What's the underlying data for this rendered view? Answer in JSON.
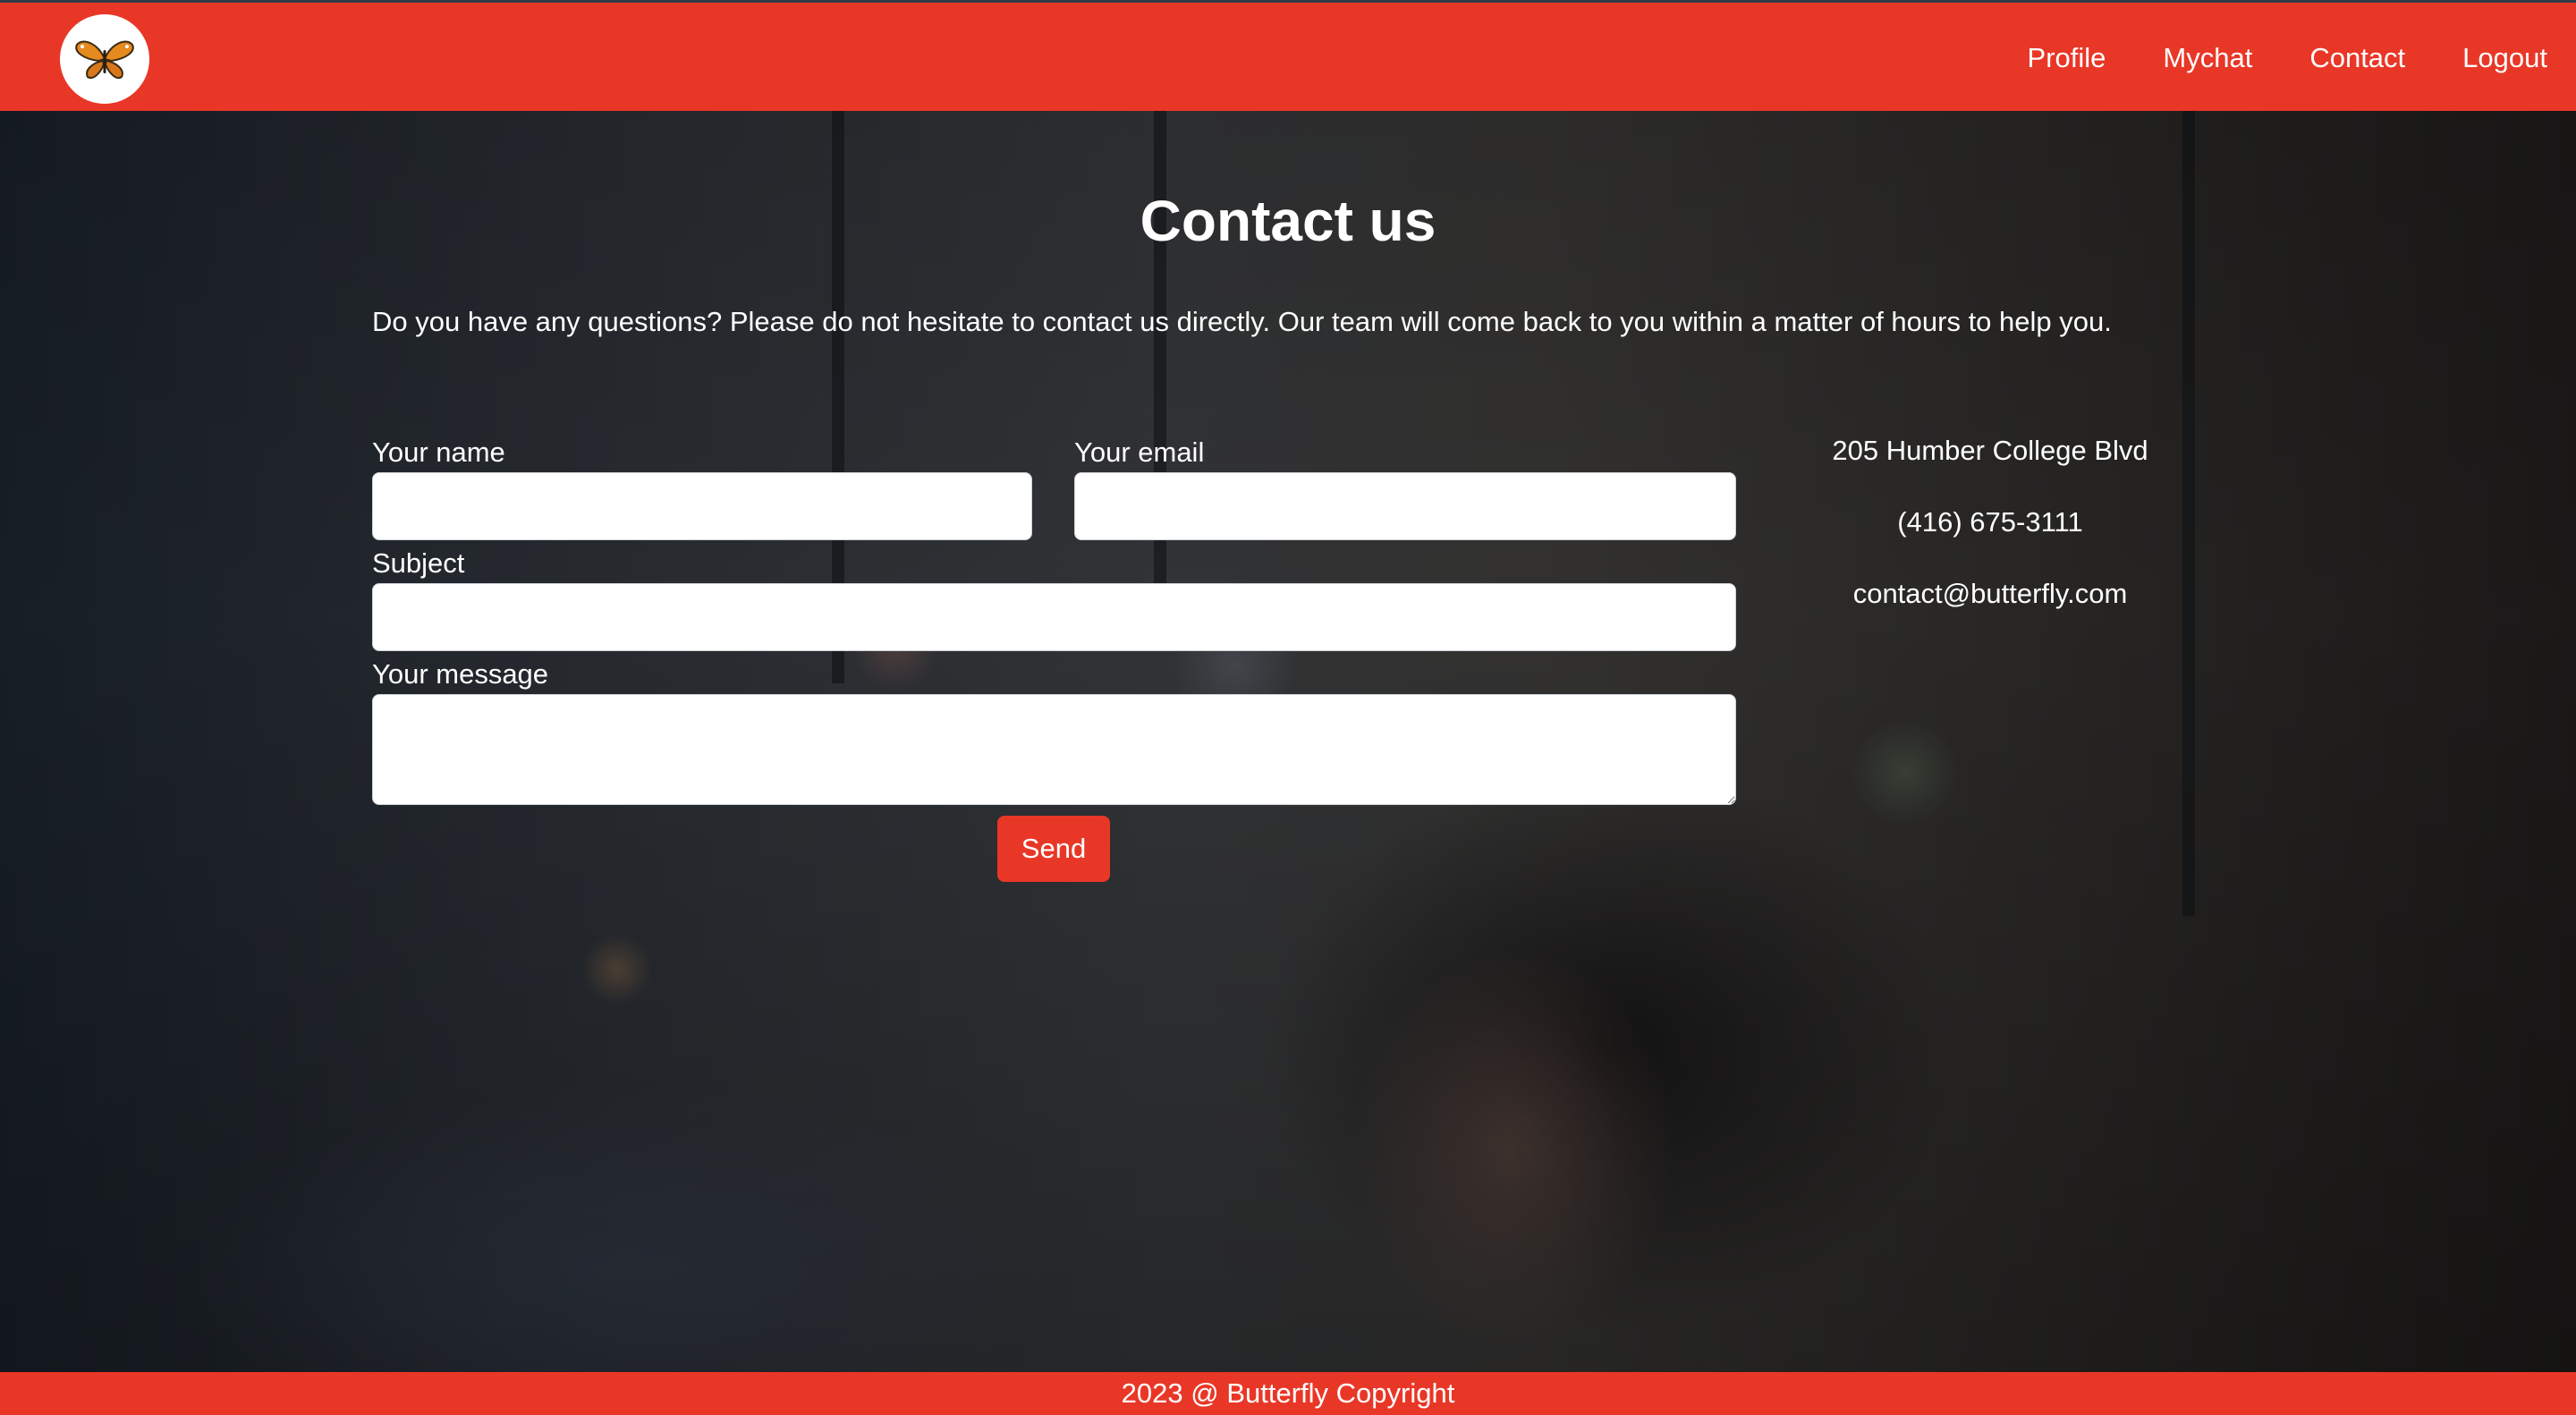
{
  "header": {
    "nav": [
      "Profile",
      "Mychat",
      "Contact",
      "Logout"
    ]
  },
  "main": {
    "title": "Contact us",
    "intro": "Do you have any questions? Please do not hesitate to contact us directly. Our team will come back to you within a matter of hours to help you.",
    "form": {
      "name_label": "Your name",
      "name_value": "",
      "email_label": "Your email",
      "email_value": "",
      "subject_label": "Subject",
      "subject_value": "",
      "message_label": "Your message",
      "message_value": "",
      "send_label": "Send"
    },
    "contact": {
      "address": "205 Humber College Blvd",
      "phone": "(416) 675-3111",
      "email": "contact@butterfly.com"
    }
  },
  "footer": {
    "text": "2023 @ Butterfly Copyright"
  },
  "colors": {
    "brand_red": "#e93727",
    "text": "#ffffff"
  },
  "icons": {
    "logo": "butterfly-icon"
  }
}
